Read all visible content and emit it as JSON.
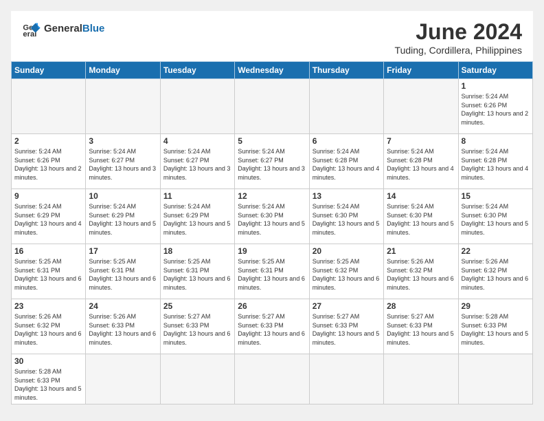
{
  "header": {
    "logo_general": "General",
    "logo_blue": "Blue",
    "month_title": "June 2024",
    "location": "Tuding, Cordillera, Philippines"
  },
  "days_of_week": [
    "Sunday",
    "Monday",
    "Tuesday",
    "Wednesday",
    "Thursday",
    "Friday",
    "Saturday"
  ],
  "weeks": [
    [
      {
        "day": "",
        "info": ""
      },
      {
        "day": "",
        "info": ""
      },
      {
        "day": "",
        "info": ""
      },
      {
        "day": "",
        "info": ""
      },
      {
        "day": "",
        "info": ""
      },
      {
        "day": "",
        "info": ""
      },
      {
        "day": "1",
        "info": "Sunrise: 5:24 AM\nSunset: 6:26 PM\nDaylight: 13 hours and 2 minutes."
      }
    ],
    [
      {
        "day": "2",
        "info": "Sunrise: 5:24 AM\nSunset: 6:26 PM\nDaylight: 13 hours and 2 minutes."
      },
      {
        "day": "3",
        "info": "Sunrise: 5:24 AM\nSunset: 6:27 PM\nDaylight: 13 hours and 3 minutes."
      },
      {
        "day": "4",
        "info": "Sunrise: 5:24 AM\nSunset: 6:27 PM\nDaylight: 13 hours and 3 minutes."
      },
      {
        "day": "5",
        "info": "Sunrise: 5:24 AM\nSunset: 6:27 PM\nDaylight: 13 hours and 3 minutes."
      },
      {
        "day": "6",
        "info": "Sunrise: 5:24 AM\nSunset: 6:28 PM\nDaylight: 13 hours and 4 minutes."
      },
      {
        "day": "7",
        "info": "Sunrise: 5:24 AM\nSunset: 6:28 PM\nDaylight: 13 hours and 4 minutes."
      },
      {
        "day": "8",
        "info": "Sunrise: 5:24 AM\nSunset: 6:28 PM\nDaylight: 13 hours and 4 minutes."
      }
    ],
    [
      {
        "day": "9",
        "info": "Sunrise: 5:24 AM\nSunset: 6:29 PM\nDaylight: 13 hours and 4 minutes."
      },
      {
        "day": "10",
        "info": "Sunrise: 5:24 AM\nSunset: 6:29 PM\nDaylight: 13 hours and 5 minutes."
      },
      {
        "day": "11",
        "info": "Sunrise: 5:24 AM\nSunset: 6:29 PM\nDaylight: 13 hours and 5 minutes."
      },
      {
        "day": "12",
        "info": "Sunrise: 5:24 AM\nSunset: 6:30 PM\nDaylight: 13 hours and 5 minutes."
      },
      {
        "day": "13",
        "info": "Sunrise: 5:24 AM\nSunset: 6:30 PM\nDaylight: 13 hours and 5 minutes."
      },
      {
        "day": "14",
        "info": "Sunrise: 5:24 AM\nSunset: 6:30 PM\nDaylight: 13 hours and 5 minutes."
      },
      {
        "day": "15",
        "info": "Sunrise: 5:24 AM\nSunset: 6:30 PM\nDaylight: 13 hours and 5 minutes."
      }
    ],
    [
      {
        "day": "16",
        "info": "Sunrise: 5:25 AM\nSunset: 6:31 PM\nDaylight: 13 hours and 6 minutes."
      },
      {
        "day": "17",
        "info": "Sunrise: 5:25 AM\nSunset: 6:31 PM\nDaylight: 13 hours and 6 minutes."
      },
      {
        "day": "18",
        "info": "Sunrise: 5:25 AM\nSunset: 6:31 PM\nDaylight: 13 hours and 6 minutes."
      },
      {
        "day": "19",
        "info": "Sunrise: 5:25 AM\nSunset: 6:31 PM\nDaylight: 13 hours and 6 minutes."
      },
      {
        "day": "20",
        "info": "Sunrise: 5:25 AM\nSunset: 6:32 PM\nDaylight: 13 hours and 6 minutes."
      },
      {
        "day": "21",
        "info": "Sunrise: 5:26 AM\nSunset: 6:32 PM\nDaylight: 13 hours and 6 minutes."
      },
      {
        "day": "22",
        "info": "Sunrise: 5:26 AM\nSunset: 6:32 PM\nDaylight: 13 hours and 6 minutes."
      }
    ],
    [
      {
        "day": "23",
        "info": "Sunrise: 5:26 AM\nSunset: 6:32 PM\nDaylight: 13 hours and 6 minutes."
      },
      {
        "day": "24",
        "info": "Sunrise: 5:26 AM\nSunset: 6:33 PM\nDaylight: 13 hours and 6 minutes."
      },
      {
        "day": "25",
        "info": "Sunrise: 5:27 AM\nSunset: 6:33 PM\nDaylight: 13 hours and 6 minutes."
      },
      {
        "day": "26",
        "info": "Sunrise: 5:27 AM\nSunset: 6:33 PM\nDaylight: 13 hours and 6 minutes."
      },
      {
        "day": "27",
        "info": "Sunrise: 5:27 AM\nSunset: 6:33 PM\nDaylight: 13 hours and 5 minutes."
      },
      {
        "day": "28",
        "info": "Sunrise: 5:27 AM\nSunset: 6:33 PM\nDaylight: 13 hours and 5 minutes."
      },
      {
        "day": "29",
        "info": "Sunrise: 5:28 AM\nSunset: 6:33 PM\nDaylight: 13 hours and 5 minutes."
      }
    ],
    [
      {
        "day": "30",
        "info": "Sunrise: 5:28 AM\nSunset: 6:33 PM\nDaylight: 13 hours and 5 minutes."
      },
      {
        "day": "",
        "info": ""
      },
      {
        "day": "",
        "info": ""
      },
      {
        "day": "",
        "info": ""
      },
      {
        "day": "",
        "info": ""
      },
      {
        "day": "",
        "info": ""
      },
      {
        "day": "",
        "info": ""
      }
    ]
  ]
}
